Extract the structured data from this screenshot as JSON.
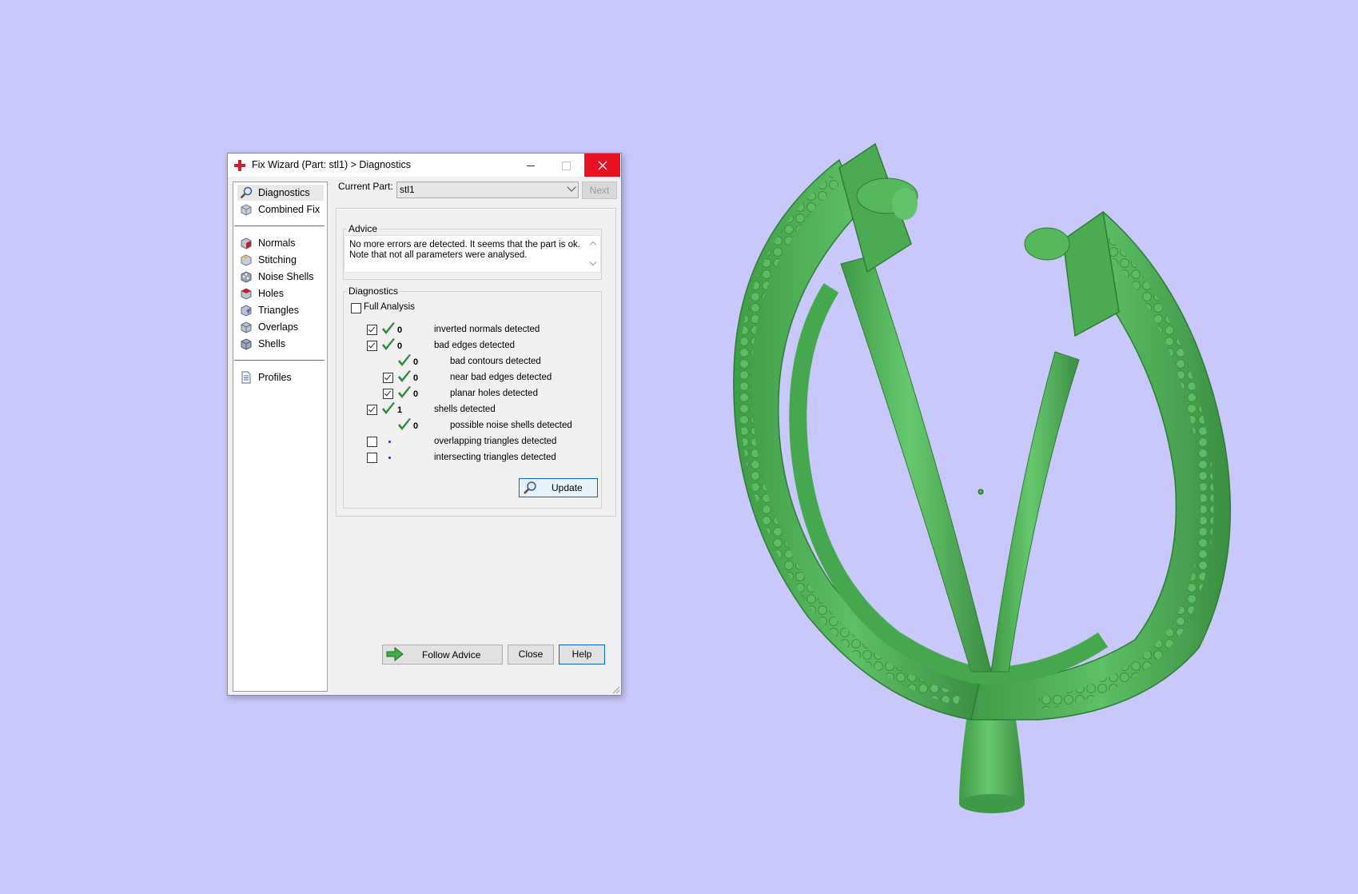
{
  "window": {
    "title": "Fix Wizard (Part: stl1) > Diagnostics",
    "minimize_icon": "minimize-icon",
    "maximize_icon": "maximize-icon",
    "close_icon": "close-icon",
    "title_icon": "red-cross-icon"
  },
  "nav": {
    "group1": [
      {
        "label": "Diagnostics",
        "icon": "magnifier-icon",
        "active": true
      },
      {
        "label": "Combined Fix",
        "icon": "cube-icon"
      }
    ],
    "group2": [
      {
        "label": "Normals",
        "icon": "normals-cube-icon"
      },
      {
        "label": "Stitching",
        "icon": "stitching-cube-icon"
      },
      {
        "label": "Noise Shells",
        "icon": "noise-shells-cube-icon"
      },
      {
        "label": "Holes",
        "icon": "holes-cube-icon"
      },
      {
        "label": "Triangles",
        "icon": "triangles-cube-icon"
      },
      {
        "label": "Overlaps",
        "icon": "overlaps-cube-icon"
      },
      {
        "label": "Shells",
        "icon": "shells-cube-icon"
      }
    ],
    "group3": [
      {
        "label": "Profiles",
        "icon": "document-icon"
      }
    ]
  },
  "current_part": {
    "label": "Current Part:",
    "value": "stl1",
    "next_label": "Next"
  },
  "advice": {
    "title": "Advice",
    "text": "No more errors are detected. It seems that the part is ok. Note that not all parameters were analysed."
  },
  "diagnostics": {
    "title": "Diagnostics",
    "full_analysis": {
      "label": "Full Analysis",
      "checked": false
    },
    "rows": [
      {
        "checkbox": true,
        "checked": true,
        "status": "check",
        "count": "0",
        "label": "inverted normals detected",
        "indent": 0
      },
      {
        "checkbox": true,
        "checked": true,
        "status": "check",
        "count": "0",
        "label": "bad edges detected",
        "indent": 0
      },
      {
        "checkbox": false,
        "status": "check",
        "count": "0",
        "label": "bad contours detected",
        "indent": 1
      },
      {
        "checkbox": true,
        "checked": true,
        "status": "check",
        "count": "0",
        "label": "near bad edges detected",
        "indent": 1
      },
      {
        "checkbox": true,
        "checked": true,
        "status": "check",
        "count": "0",
        "label": "planar holes detected",
        "indent": 1
      },
      {
        "checkbox": true,
        "checked": true,
        "status": "check",
        "count": "1",
        "label": "shells detected",
        "indent": 0
      },
      {
        "checkbox": false,
        "status": "check",
        "count": "0",
        "label": "possible noise shells detected",
        "indent": 1
      },
      {
        "checkbox": true,
        "checked": false,
        "status": "dot",
        "count": "",
        "label": "overlapping triangles detected",
        "indent": 0
      },
      {
        "checkbox": true,
        "checked": false,
        "status": "dot",
        "count": "",
        "label": "intersecting triangles detected",
        "indent": 0
      }
    ],
    "update_label": "Update",
    "status_check_icon": "green-check-icon",
    "status_dot_icon": "pending-dot-icon"
  },
  "buttons": {
    "follow_advice": "Follow Advice",
    "close": "Close",
    "help": "Help",
    "follow_icon": "green-arrow-icon"
  },
  "colors": {
    "background": "#c8c8fa",
    "model_green": "#4caf50",
    "close_hover": "#e81123",
    "check_green": "#2e8b3c"
  }
}
